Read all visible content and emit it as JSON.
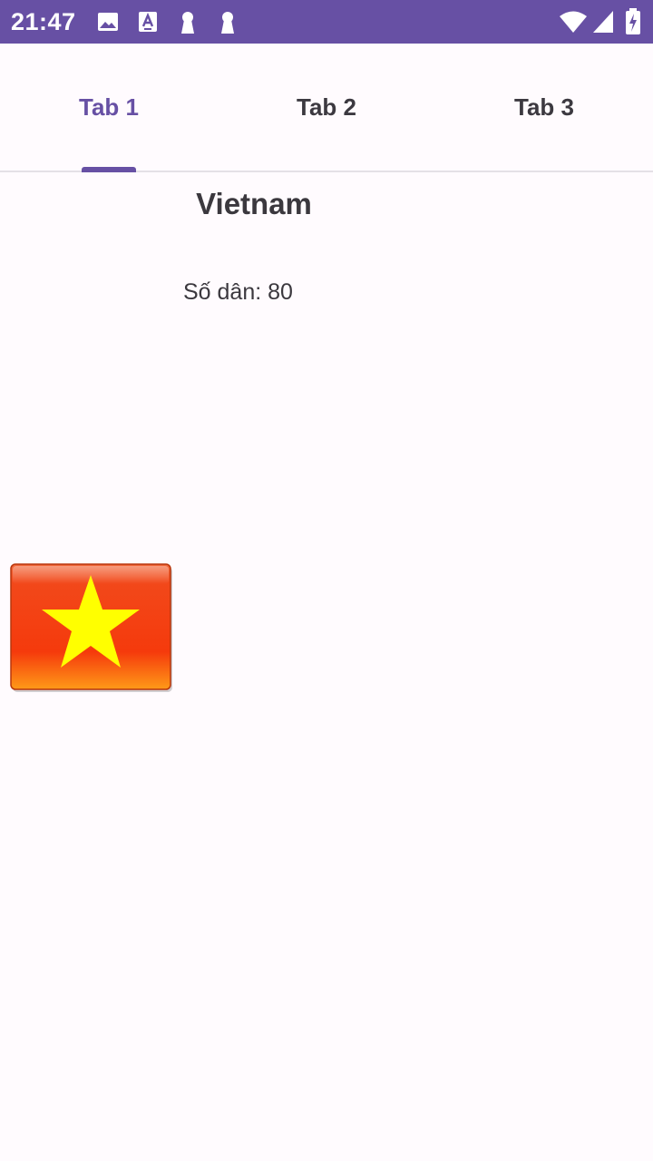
{
  "status_bar": {
    "time": "21:47",
    "icons": [
      "image-icon",
      "text-a-icon",
      "keyhole-icon",
      "keyhole-icon",
      "wifi-icon",
      "cellular-signal-icon",
      "battery-charging-icon"
    ]
  },
  "tabs": [
    {
      "label": "Tab 1",
      "active": true
    },
    {
      "label": "Tab 2",
      "active": false
    },
    {
      "label": "Tab 3",
      "active": false
    }
  ],
  "content": {
    "country_name": "Vietnam",
    "population": "Số dân: 80",
    "flag_icon": "vietnam-flag-icon"
  },
  "colors": {
    "accent": "#6750a4",
    "background": "#fffbfe",
    "text": "#3b383e",
    "flag_red": "#f23c10",
    "flag_star": "#ffff00"
  }
}
